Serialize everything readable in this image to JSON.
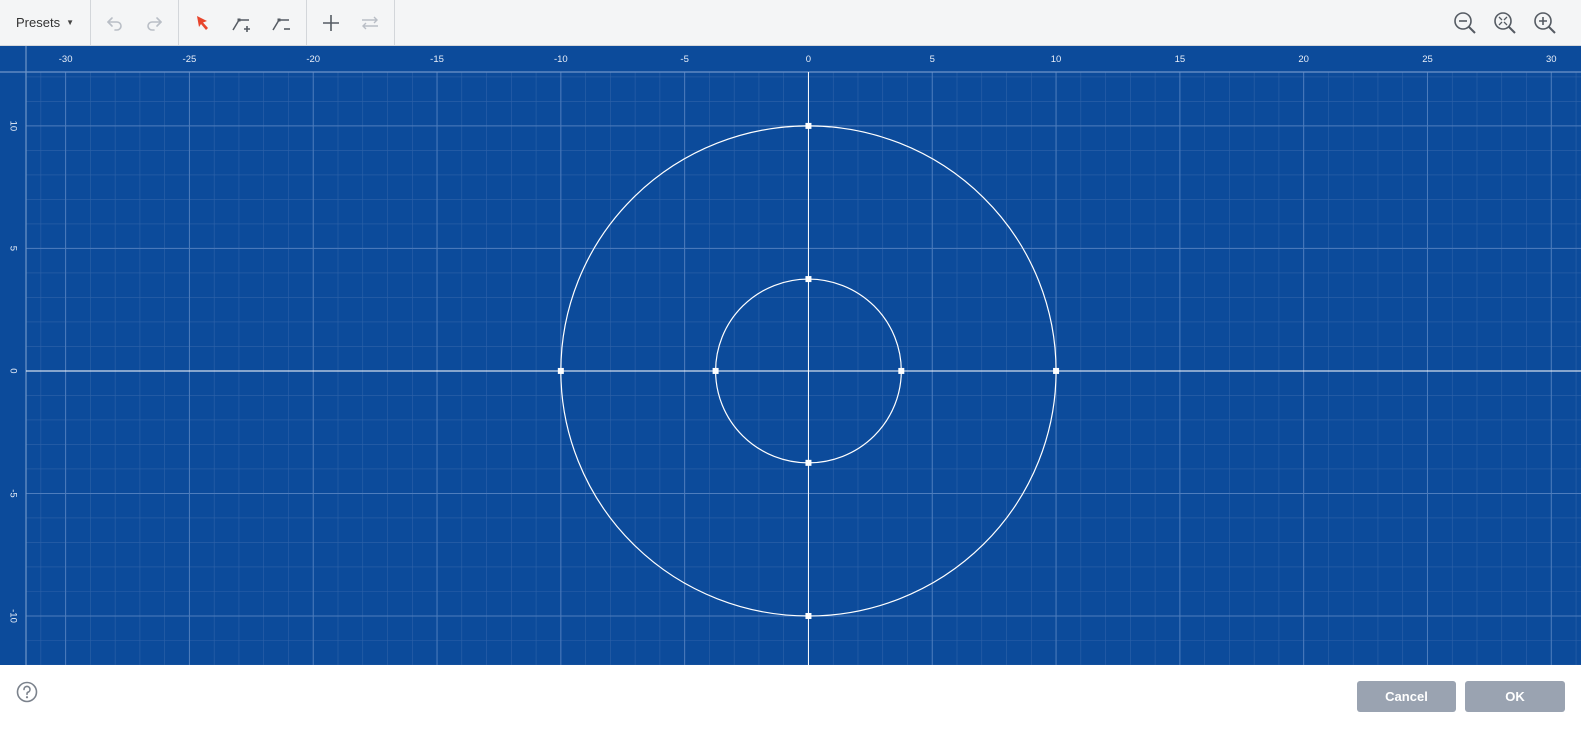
{
  "toolbar": {
    "presets_label": "Presets",
    "tools": [
      {
        "name": "undo-icon",
        "enabled": false
      },
      {
        "name": "redo-icon",
        "enabled": false
      },
      {
        "name": "select-pointer-icon",
        "active": true
      },
      {
        "name": "add-point-icon"
      },
      {
        "name": "remove-point-icon"
      },
      {
        "name": "add-shape-icon"
      },
      {
        "name": "flip-icon",
        "enabled": false
      },
      {
        "name": "zoom-out-icon"
      },
      {
        "name": "zoom-fit-icon"
      },
      {
        "name": "zoom-in-icon"
      }
    ]
  },
  "colors": {
    "canvas_bg": "#0c4b9b",
    "grid_minor": "#2f63a9",
    "grid_major": "#4e7dbd",
    "axis": "#ffffff",
    "shape": "#ffffff",
    "active_tool": "#e8452c",
    "button_bg": "#9aa3b1"
  },
  "chart_data": {
    "type": "scatter",
    "xlabel": "",
    "ylabel": "",
    "xlim": [
      -31.6,
      31.2
    ],
    "ylim": [
      -12.0,
      12.2
    ],
    "x_ticks": [
      -30,
      -25,
      -20,
      -15,
      -10,
      -5,
      0,
      5,
      10,
      15,
      20,
      25,
      30
    ],
    "y_ticks": [
      10,
      5,
      0,
      -5,
      -10
    ],
    "grid": true,
    "minor_step": 1,
    "shapes": [
      {
        "kind": "circle",
        "center": [
          0,
          0
        ],
        "radius": 10,
        "control_points": [
          [
            0,
            10
          ],
          [
            10,
            0
          ],
          [
            0,
            -10
          ],
          [
            -10,
            0
          ]
        ]
      },
      {
        "kind": "circle",
        "center": [
          0,
          0
        ],
        "radius": 3.75,
        "control_points": [
          [
            0,
            3.75
          ],
          [
            3.75,
            0
          ],
          [
            0,
            -3.75
          ],
          [
            -3.75,
            0
          ]
        ]
      }
    ]
  },
  "footer": {
    "help_icon": "question-circle-icon",
    "cancel_label": "Cancel",
    "ok_label": "OK"
  }
}
